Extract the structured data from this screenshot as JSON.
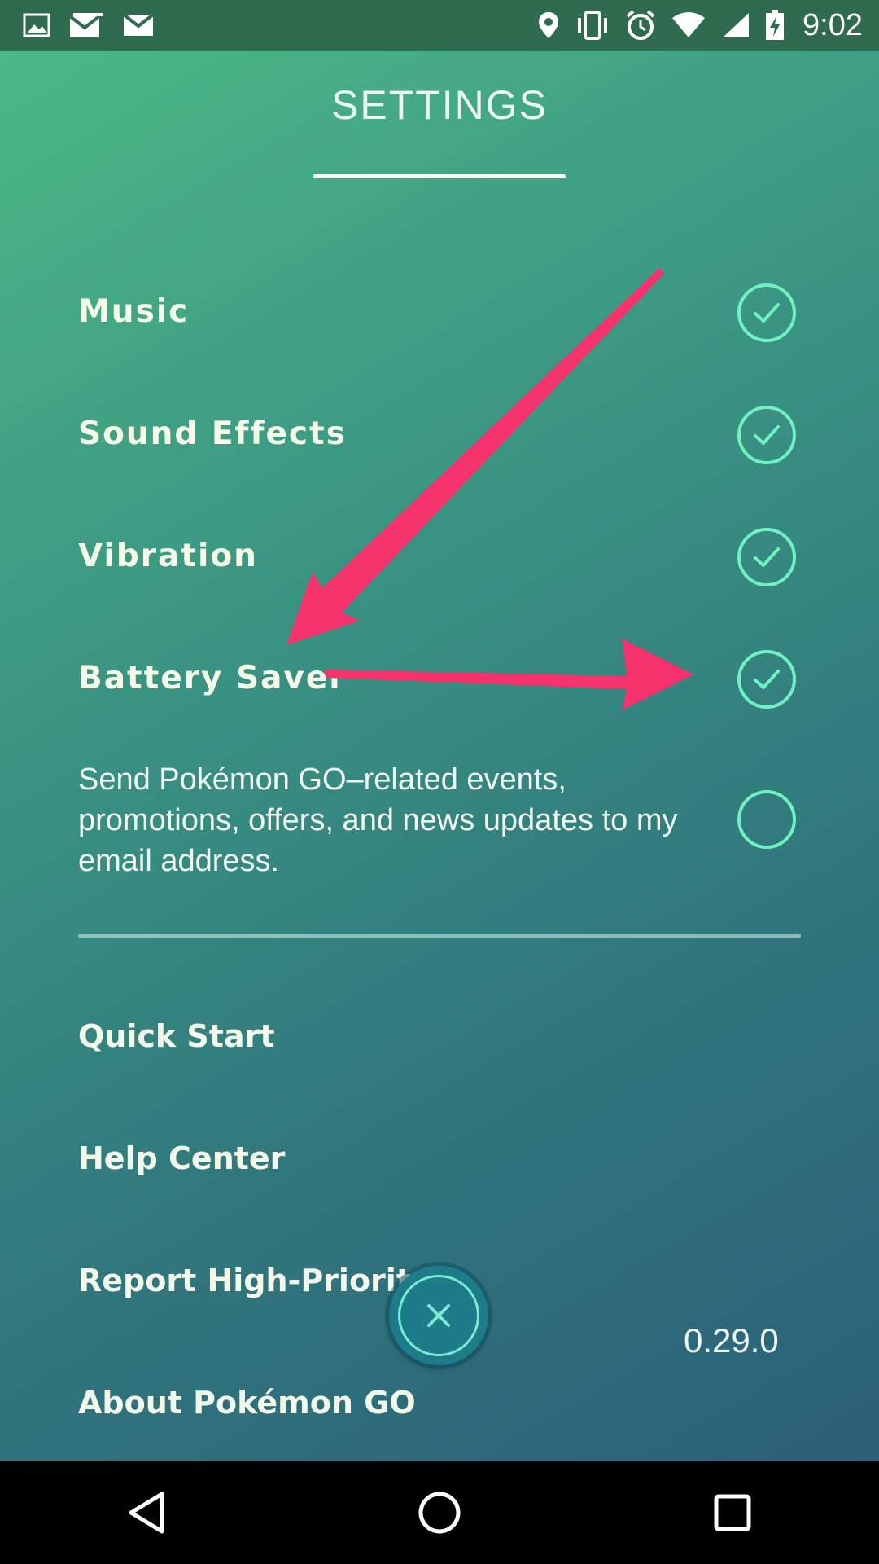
{
  "status_bar": {
    "time": "9:02",
    "left_icons": [
      "image-icon",
      "gmail-icon",
      "gmail-icon"
    ],
    "right_icons": [
      "location-icon",
      "vibrate-icon",
      "alarm-icon",
      "wifi-icon",
      "signal-icon",
      "battery-charging-icon"
    ]
  },
  "settings": {
    "title": "SETTINGS",
    "options": [
      {
        "label": "Music",
        "checked": true
      },
      {
        "label": "Sound Effects",
        "checked": true
      },
      {
        "label": "Vibration",
        "checked": true
      },
      {
        "label": "Battery Saver",
        "checked": true
      }
    ],
    "email_opt_in": {
      "text": "Send Pokémon GO–related events, promotions, offers, and news updates to my email address.",
      "checked": false
    },
    "links": [
      "Quick Start",
      "Help Center",
      "Report High-Priority I",
      "About Pokémon GO"
    ],
    "version": "0.29.0"
  },
  "annotations": {
    "arrow_color": "#f4336c"
  },
  "colors": {
    "accent_check": "#6ff2bf",
    "status_bar_bg": "#2e6b4f"
  },
  "nav_bar": {
    "buttons": [
      "back-icon",
      "home-icon",
      "recents-icon"
    ]
  }
}
